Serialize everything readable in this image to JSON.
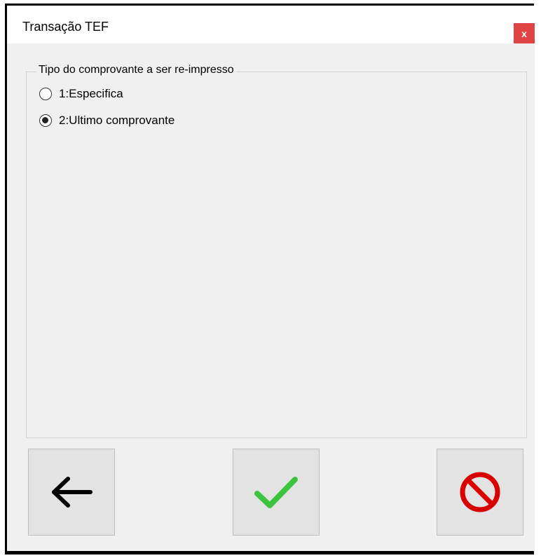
{
  "window": {
    "title": "Transação TEF",
    "close_label": "x"
  },
  "groupbox": {
    "legend": "Tipo do comprovante a ser re-impresso",
    "options": [
      {
        "label": "1:Especifica",
        "checked": false
      },
      {
        "label": "2:Ultimo comprovante",
        "checked": true
      }
    ]
  },
  "buttons": {
    "back": {
      "icon": "arrow-left-icon",
      "color": "#000000"
    },
    "confirm": {
      "icon": "checkmark-icon",
      "color": "#3cc43c"
    },
    "cancel": {
      "icon": "prohibited-icon",
      "color": "#d90000"
    }
  },
  "colors": {
    "close_button": "#e04343",
    "client_background": "#f0f0f0",
    "button_face": "#e3e3e3"
  }
}
